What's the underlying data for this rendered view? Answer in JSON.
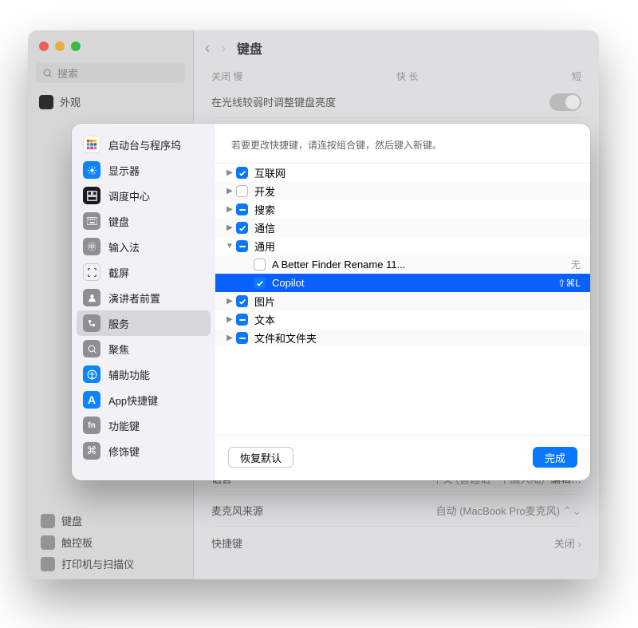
{
  "window": {
    "search_placeholder": "搜索",
    "header_title": "键盘",
    "back_sidebar": [
      {
        "label": "外观",
        "icon": "appearance"
      }
    ],
    "dim_row": {
      "label": "在光线较弱时调整键盘亮度",
      "toggle": false
    },
    "blur": {
      "top_left": "关闭 慢",
      "top_right": "快    长",
      "top_end": "短"
    },
    "lang_row": {
      "label": "语言",
      "value": "中文 (普通话 - 中国大陆)",
      "action": "编辑…"
    },
    "mic_row": {
      "label": "麦克风来源",
      "value": "自动 (MacBook Pro麦克风)"
    },
    "shortcut_row": {
      "label": "快捷键",
      "value": "关闭"
    },
    "bottom_sidebar": [
      {
        "label": "键盘"
      },
      {
        "label": "触控板"
      },
      {
        "label": "打印机与扫描仪"
      }
    ]
  },
  "sheet": {
    "hint": "若要更改快捷键，请连按组合键，然后键入新键。",
    "menu": [
      {
        "label": "启动台与程序坞",
        "icon": "launch"
      },
      {
        "label": "显示器",
        "icon": "disp"
      },
      {
        "label": "调度中心",
        "icon": "mc"
      },
      {
        "label": "键盘",
        "icon": "kb"
      },
      {
        "label": "输入法",
        "icon": "input"
      },
      {
        "label": "截屏",
        "icon": "screen"
      },
      {
        "label": "演讲者前置",
        "icon": "pres"
      },
      {
        "label": "服务",
        "icon": "serv",
        "selected": true
      },
      {
        "label": "聚焦",
        "icon": "focus"
      },
      {
        "label": "辅助功能",
        "icon": "acc"
      },
      {
        "label": "App快捷键",
        "icon": "app"
      },
      {
        "label": "功能键",
        "icon": "fn"
      },
      {
        "label": "修饰键",
        "icon": "mod"
      }
    ],
    "tree": [
      {
        "indent": 0,
        "disclosure": ">",
        "state": "checked",
        "label": "互联网",
        "shortcut": ""
      },
      {
        "indent": 0,
        "disclosure": ">",
        "state": "unchecked",
        "label": "开发",
        "shortcut": ""
      },
      {
        "indent": 0,
        "disclosure": ">",
        "state": "mixed",
        "label": "搜索",
        "shortcut": ""
      },
      {
        "indent": 0,
        "disclosure": ">",
        "state": "checked",
        "label": "通信",
        "shortcut": ""
      },
      {
        "indent": 0,
        "disclosure": "v",
        "state": "mixed",
        "label": "通用",
        "shortcut": ""
      },
      {
        "indent": 1,
        "disclosure": "",
        "state": "unchecked",
        "label": "A Better Finder Rename 11...",
        "shortcut": "无"
      },
      {
        "indent": 1,
        "disclosure": "",
        "state": "checked",
        "label": "Copilot",
        "shortcut": "⇧⌘L",
        "selected": true
      },
      {
        "indent": 0,
        "disclosure": ">",
        "state": "checked",
        "label": "图片",
        "shortcut": ""
      },
      {
        "indent": 0,
        "disclosure": ">",
        "state": "mixed",
        "label": "文本",
        "shortcut": ""
      },
      {
        "indent": 0,
        "disclosure": ">",
        "state": "mixed",
        "label": "文件和文件夹",
        "shortcut": ""
      }
    ],
    "reset_label": "恢复默认",
    "done_label": "完成"
  }
}
